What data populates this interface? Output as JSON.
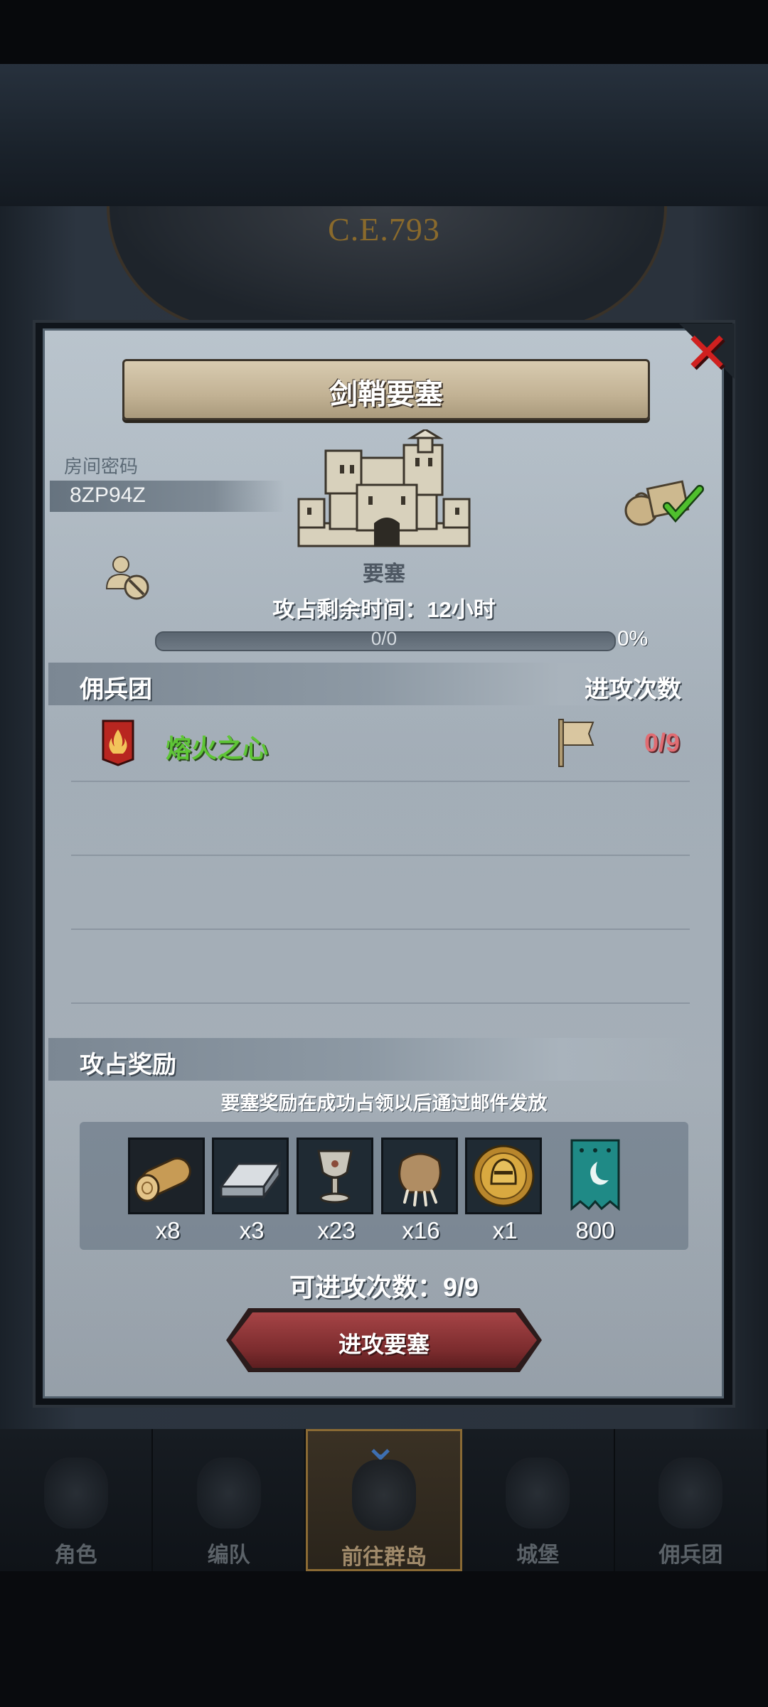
{
  "background": {
    "era": "C.E.793"
  },
  "dialog": {
    "title": "剑鞘要塞",
    "room_password_label": "房间密码",
    "room_password": "8ZP94Z",
    "fortress_label": "要塞",
    "time_remaining": "攻占剩余时间：12小时",
    "progress": {
      "text": "0/0",
      "percent_text": "0%",
      "fraction": 0
    },
    "mercenary_header": "佣兵团",
    "attack_count_header": "进攻次数",
    "mercenaries": [
      {
        "name": "熔火之心",
        "attacks": "0/9"
      }
    ],
    "rewards_header": "攻占奖励",
    "rewards_note": "要塞奖励在成功占领以后通过邮件发放",
    "rewards": [
      {
        "icon": "wood-log-icon",
        "qty": "x8"
      },
      {
        "icon": "iron-ingot-icon",
        "qty": "x3"
      },
      {
        "icon": "goblet-icon",
        "qty": "x23"
      },
      {
        "icon": "beast-paw-icon",
        "qty": "x16"
      },
      {
        "icon": "knight-medal-icon",
        "qty": "x1"
      },
      {
        "icon": "guild-banner-icon",
        "qty": "800"
      }
    ],
    "available_attacks": "可进攻次数：9/9",
    "attack_button": "进攻要塞"
  },
  "nav": [
    {
      "label": "角色",
      "icon": "character-icon"
    },
    {
      "label": "编队",
      "icon": "formation-icon"
    },
    {
      "label": "前往群岛",
      "icon": "islands-compass-icon",
      "active": true
    },
    {
      "label": "城堡",
      "icon": "castle-icon"
    },
    {
      "label": "佣兵团",
      "icon": "mercenary-icon"
    }
  ],
  "colors": {
    "merc_name": "#5ec536",
    "attacks_value": "#e06c72",
    "close_x": "#d0201f",
    "attack_button": "#8e3436"
  }
}
